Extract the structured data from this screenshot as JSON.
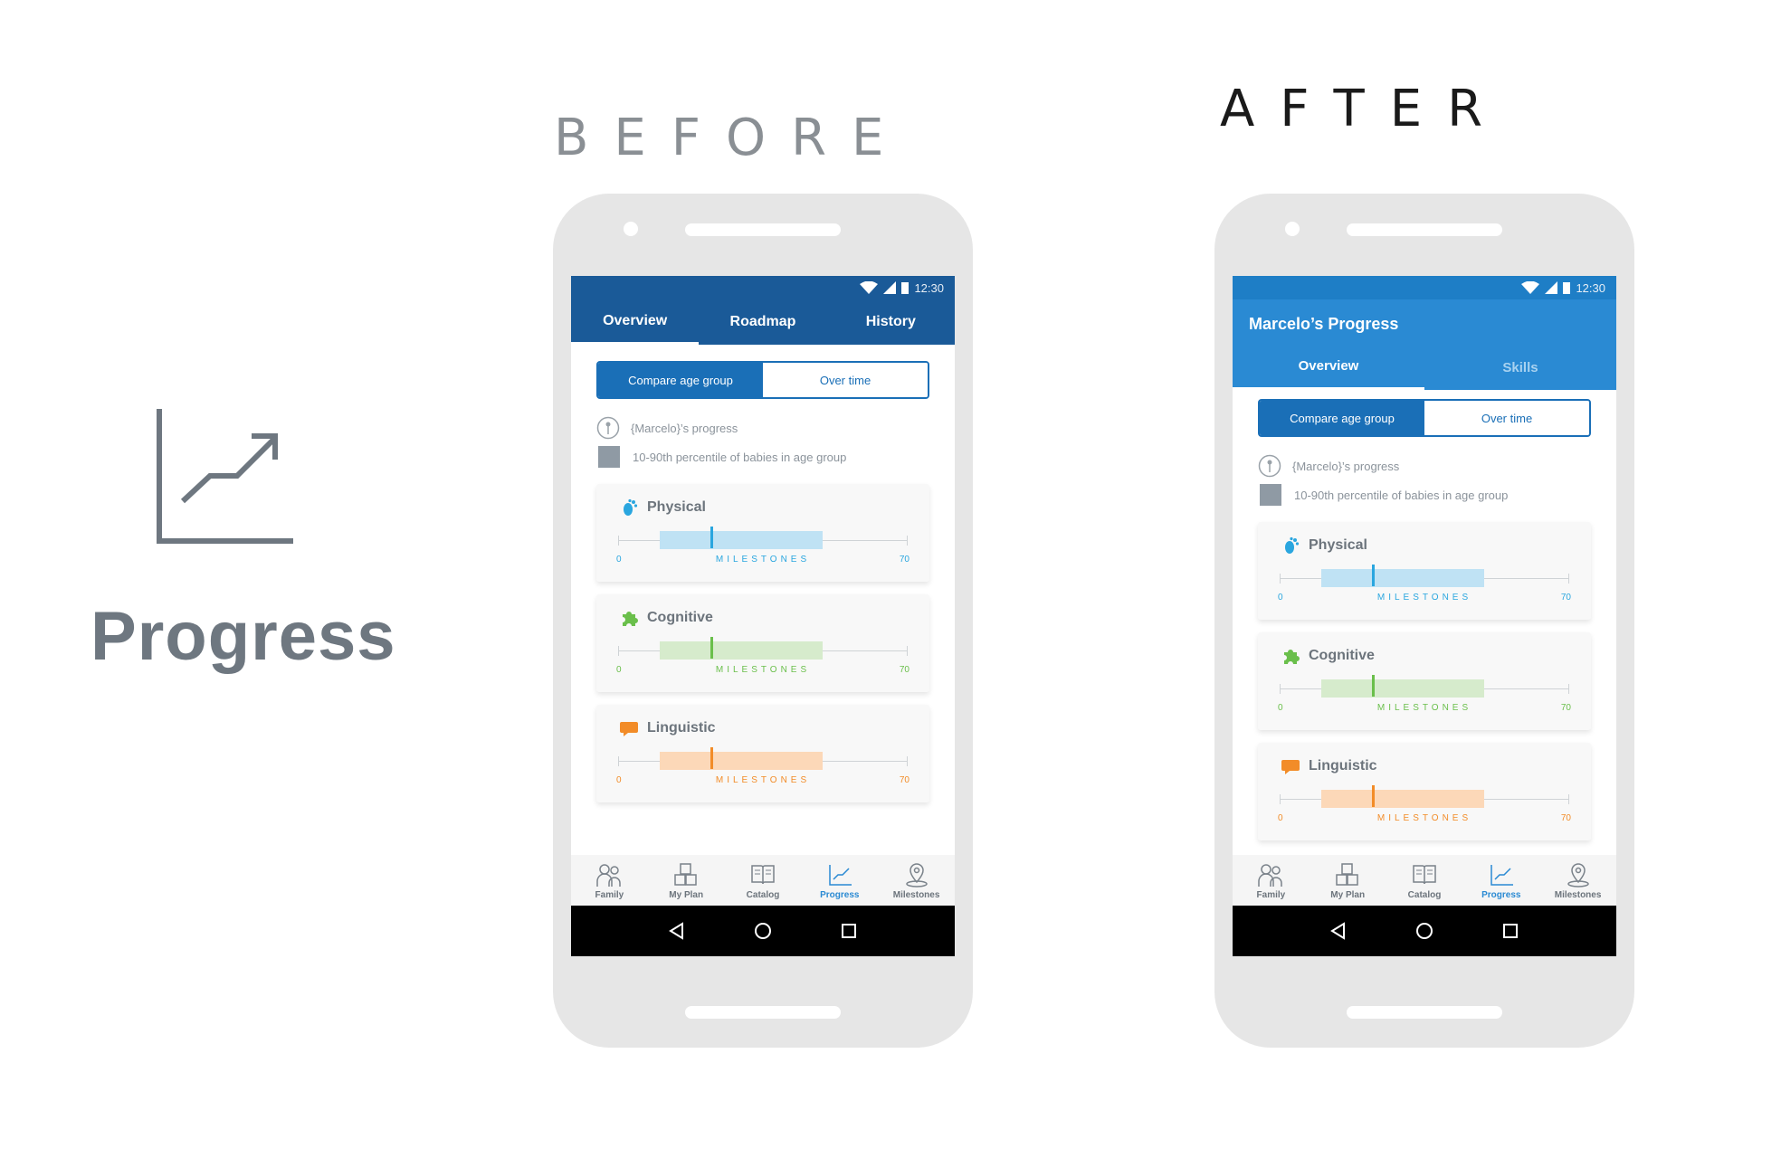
{
  "feature": {
    "title": "Progress",
    "icon": "chart-trend-icon"
  },
  "labels": {
    "before": "BEFORE",
    "after": "AFTER"
  },
  "before": {
    "status_time": "12:30",
    "tabs": [
      "Overview",
      "Roadmap",
      "History"
    ],
    "active_tab": "Overview"
  },
  "after": {
    "status_time": "12:30",
    "title": "Marcelo’s Progress",
    "tabs": [
      "Overview",
      "Skills"
    ],
    "active_tab": "Overview"
  },
  "toggle": {
    "compare": "Compare age group",
    "over_time": "Over time",
    "selected": "Compare age group"
  },
  "legend": {
    "progress": "{Marcelo}’s progress",
    "percentile": "10-90th percentile of babies in age group"
  },
  "cards": [
    {
      "name": "Physical",
      "icon": "footprint-icon",
      "color": "#2aa6df",
      "range_color": "#bfe2f4",
      "min": "0",
      "max": "70",
      "axis": "MILESTONES"
    },
    {
      "name": "Cognitive",
      "icon": "puzzle-icon",
      "color": "#6abf4b",
      "range_color": "#d6ebcc",
      "min": "0",
      "max": "70",
      "axis": "MILESTONES"
    },
    {
      "name": "Linguistic",
      "icon": "speech-bubble-icon",
      "color": "#f28c28",
      "range_color": "#fcd8b8",
      "min": "0",
      "max": "70",
      "axis": "MILESTONES"
    }
  ],
  "nav": [
    {
      "label": "Family",
      "icon": "family-icon"
    },
    {
      "label": "My Plan",
      "icon": "blocks-icon"
    },
    {
      "label": "Catalog",
      "icon": "book-icon"
    },
    {
      "label": "Progress",
      "icon": "chart-icon"
    },
    {
      "label": "Milestones",
      "icon": "map-pin-icon"
    }
  ],
  "active_nav": "Progress",
  "colors": {
    "before_header": "#1a5a98",
    "after_header": "#2a8ad3",
    "accent": "#1a6fb7"
  }
}
